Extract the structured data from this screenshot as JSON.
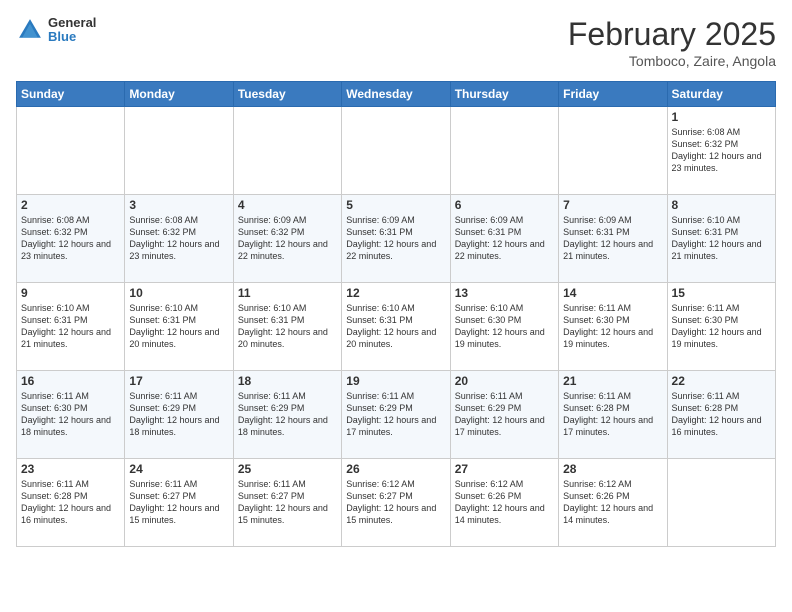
{
  "header": {
    "logo": {
      "line1": "General",
      "line2": "Blue"
    },
    "title": "February 2025",
    "location": "Tomboco, Zaire, Angola"
  },
  "days_of_week": [
    "Sunday",
    "Monday",
    "Tuesday",
    "Wednesday",
    "Thursday",
    "Friday",
    "Saturday"
  ],
  "weeks": [
    [
      {
        "day": "",
        "info": ""
      },
      {
        "day": "",
        "info": ""
      },
      {
        "day": "",
        "info": ""
      },
      {
        "day": "",
        "info": ""
      },
      {
        "day": "",
        "info": ""
      },
      {
        "day": "",
        "info": ""
      },
      {
        "day": "1",
        "info": "Sunrise: 6:08 AM\nSunset: 6:32 PM\nDaylight: 12 hours and 23 minutes."
      }
    ],
    [
      {
        "day": "2",
        "info": "Sunrise: 6:08 AM\nSunset: 6:32 PM\nDaylight: 12 hours and 23 minutes."
      },
      {
        "day": "3",
        "info": "Sunrise: 6:08 AM\nSunset: 6:32 PM\nDaylight: 12 hours and 23 minutes."
      },
      {
        "day": "4",
        "info": "Sunrise: 6:09 AM\nSunset: 6:32 PM\nDaylight: 12 hours and 22 minutes."
      },
      {
        "day": "5",
        "info": "Sunrise: 6:09 AM\nSunset: 6:31 PM\nDaylight: 12 hours and 22 minutes."
      },
      {
        "day": "6",
        "info": "Sunrise: 6:09 AM\nSunset: 6:31 PM\nDaylight: 12 hours and 22 minutes."
      },
      {
        "day": "7",
        "info": "Sunrise: 6:09 AM\nSunset: 6:31 PM\nDaylight: 12 hours and 21 minutes."
      },
      {
        "day": "8",
        "info": "Sunrise: 6:10 AM\nSunset: 6:31 PM\nDaylight: 12 hours and 21 minutes."
      }
    ],
    [
      {
        "day": "9",
        "info": "Sunrise: 6:10 AM\nSunset: 6:31 PM\nDaylight: 12 hours and 21 minutes."
      },
      {
        "day": "10",
        "info": "Sunrise: 6:10 AM\nSunset: 6:31 PM\nDaylight: 12 hours and 20 minutes."
      },
      {
        "day": "11",
        "info": "Sunrise: 6:10 AM\nSunset: 6:31 PM\nDaylight: 12 hours and 20 minutes."
      },
      {
        "day": "12",
        "info": "Sunrise: 6:10 AM\nSunset: 6:31 PM\nDaylight: 12 hours and 20 minutes."
      },
      {
        "day": "13",
        "info": "Sunrise: 6:10 AM\nSunset: 6:30 PM\nDaylight: 12 hours and 19 minutes."
      },
      {
        "day": "14",
        "info": "Sunrise: 6:11 AM\nSunset: 6:30 PM\nDaylight: 12 hours and 19 minutes."
      },
      {
        "day": "15",
        "info": "Sunrise: 6:11 AM\nSunset: 6:30 PM\nDaylight: 12 hours and 19 minutes."
      }
    ],
    [
      {
        "day": "16",
        "info": "Sunrise: 6:11 AM\nSunset: 6:30 PM\nDaylight: 12 hours and 18 minutes."
      },
      {
        "day": "17",
        "info": "Sunrise: 6:11 AM\nSunset: 6:29 PM\nDaylight: 12 hours and 18 minutes."
      },
      {
        "day": "18",
        "info": "Sunrise: 6:11 AM\nSunset: 6:29 PM\nDaylight: 12 hours and 18 minutes."
      },
      {
        "day": "19",
        "info": "Sunrise: 6:11 AM\nSunset: 6:29 PM\nDaylight: 12 hours and 17 minutes."
      },
      {
        "day": "20",
        "info": "Sunrise: 6:11 AM\nSunset: 6:29 PM\nDaylight: 12 hours and 17 minutes."
      },
      {
        "day": "21",
        "info": "Sunrise: 6:11 AM\nSunset: 6:28 PM\nDaylight: 12 hours and 17 minutes."
      },
      {
        "day": "22",
        "info": "Sunrise: 6:11 AM\nSunset: 6:28 PM\nDaylight: 12 hours and 16 minutes."
      }
    ],
    [
      {
        "day": "23",
        "info": "Sunrise: 6:11 AM\nSunset: 6:28 PM\nDaylight: 12 hours and 16 minutes."
      },
      {
        "day": "24",
        "info": "Sunrise: 6:11 AM\nSunset: 6:27 PM\nDaylight: 12 hours and 15 minutes."
      },
      {
        "day": "25",
        "info": "Sunrise: 6:11 AM\nSunset: 6:27 PM\nDaylight: 12 hours and 15 minutes."
      },
      {
        "day": "26",
        "info": "Sunrise: 6:12 AM\nSunset: 6:27 PM\nDaylight: 12 hours and 15 minutes."
      },
      {
        "day": "27",
        "info": "Sunrise: 6:12 AM\nSunset: 6:26 PM\nDaylight: 12 hours and 14 minutes."
      },
      {
        "day": "28",
        "info": "Sunrise: 6:12 AM\nSunset: 6:26 PM\nDaylight: 12 hours and 14 minutes."
      },
      {
        "day": "",
        "info": ""
      }
    ]
  ]
}
